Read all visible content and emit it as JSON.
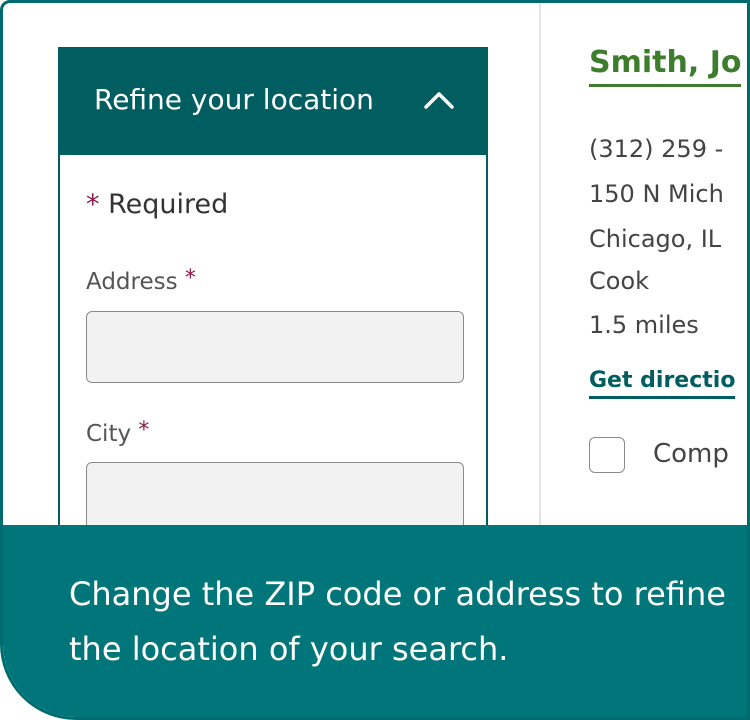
{
  "refine": {
    "title": "Refine your location",
    "required_asterisk": "*",
    "required_label": "Required",
    "address_label": "Address",
    "address_asterisk": "*",
    "address_value": "",
    "city_label": "City",
    "city_asterisk": "*",
    "city_value": "",
    "expanded": true,
    "toggle_icon": "chevron-up-icon"
  },
  "result": {
    "name": "Smith, Jo",
    "phone": "(312) 259 -",
    "street": "150 N Mich",
    "city_state": "Chicago, IL",
    "county": "Cook",
    "distance": "1.5 miles",
    "directions_label": "Get directio",
    "compare_label": "Comp",
    "compare_checked": false
  },
  "tooltip": {
    "text": "Change the ZIP code or address to refine the location of your search."
  },
  "colors": {
    "teal_dark": "#005e61",
    "teal_callout": "#00767a",
    "green_name": "#3e7d2d",
    "asterisk": "#8b1a4b"
  }
}
